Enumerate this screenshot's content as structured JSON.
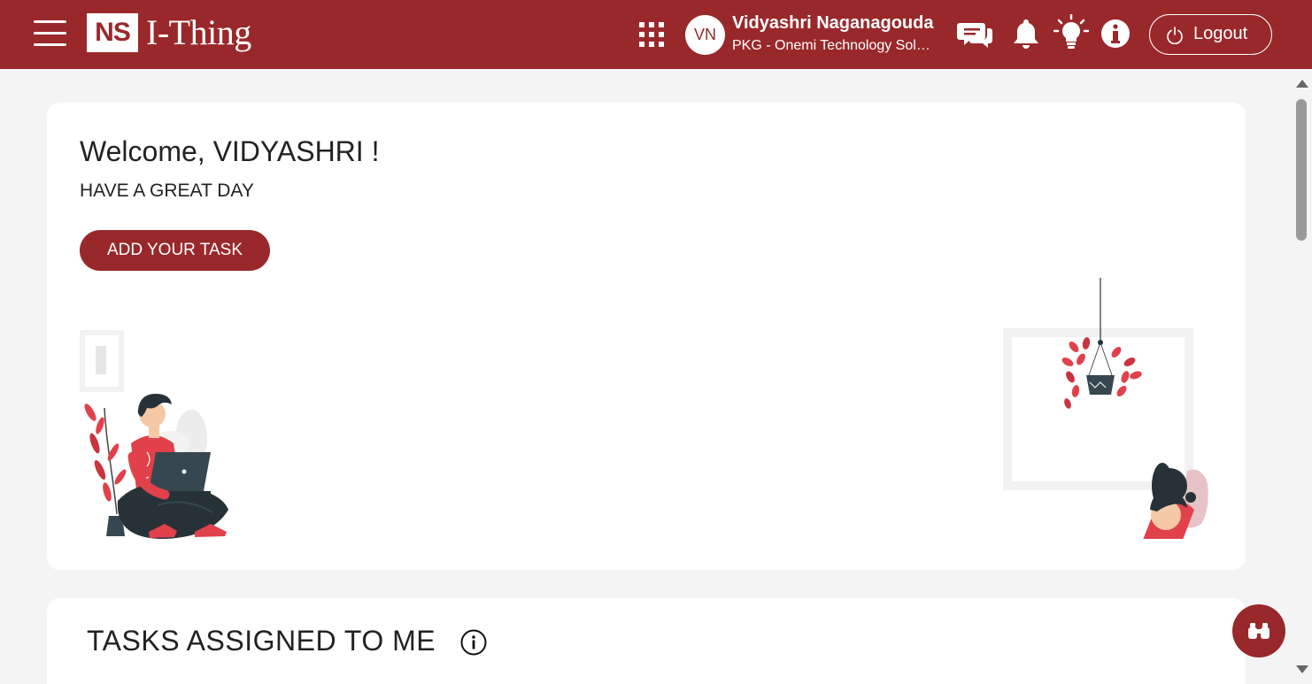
{
  "header": {
    "logo_mark": "NS",
    "logo_text": "I-Thing",
    "avatar_initials": "VN",
    "user_name": "Vidyashri Naganagouda",
    "user_org": "PKG - Onemi Technology Solutions",
    "logout_label": "Logout",
    "icons": [
      "menu-icon",
      "apps-grid-icon",
      "chat-icon",
      "bell-icon",
      "bulb-icon",
      "info-icon",
      "power-icon"
    ]
  },
  "welcome": {
    "title": "Welcome, VIDYASHRI !",
    "subtitle": "HAVE A GREAT DAY",
    "add_task_label": "ADD YOUR TASK"
  },
  "tasks": {
    "title": "TASKS ASSIGNED TO ME"
  },
  "colors": {
    "brand": "#99282b",
    "accent_red": "#e0414b",
    "background": "#f4f4f4"
  },
  "fab_icon": "binoculars-icon"
}
